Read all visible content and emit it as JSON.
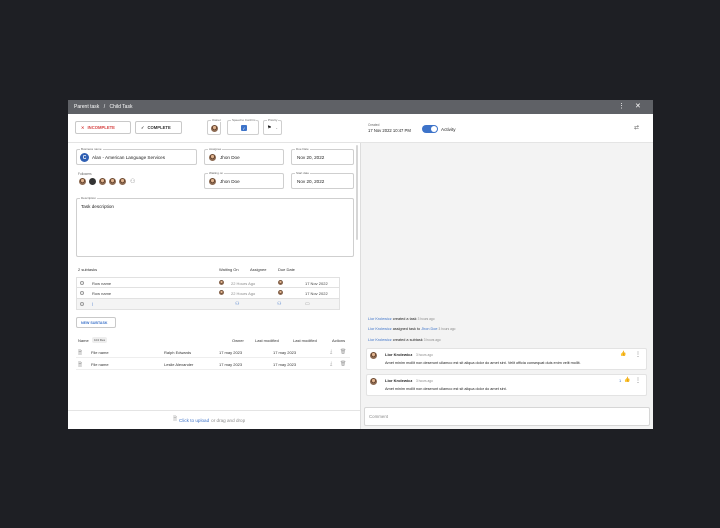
{
  "titlebar": {
    "parent": "Parent task",
    "separator": "/",
    "child": "Child Task"
  },
  "actions": {
    "incomplete_label": "INCOMPLETE",
    "complete_label": "COMPLETE"
  },
  "meta": {
    "owner_label": "Owner",
    "speed_label": "Speed to Confirm",
    "priority_label": "Priority",
    "priority_value": "-"
  },
  "created": {
    "label": "Created",
    "value": "17 Nov 2022 10:47 PM"
  },
  "activity_label": "Activity",
  "fields": {
    "business_name_label": "Business name",
    "business_name_value": "Alan - American Language Services",
    "assignee_label": "Assignee",
    "assignee_value": "Jhon Doe",
    "due_date_label": "Due Date",
    "due_date_value": "Nov 20, 2022",
    "followers_label": "Followers",
    "waiting_label": "Waiting on",
    "waiting_value": "Jhon Doe",
    "start_date_label": "Start date",
    "start_date_value": "Nov 20, 2022",
    "description_label": "Description",
    "description_value": "Task description"
  },
  "subtasks": {
    "header": "2 subtasks",
    "col_waiting": "Waiting On",
    "col_assignee": "Assignee",
    "col_due": "Due Date",
    "rows": [
      {
        "name": "Row name",
        "waiting": "22 Hours Ago",
        "due": "17 Nov 2022"
      },
      {
        "name": "Row name",
        "waiting": "22 Hours Ago",
        "due": "17 Nov 2022"
      }
    ],
    "new_row_placeholder": "|",
    "new_button": "NEW SUBTASK"
  },
  "files": {
    "col_name": "Name",
    "size_badge": "104 files",
    "col_owner": "Owner",
    "col_lastmod1": "Last modified",
    "col_lastmod2": "Last modified",
    "col_actions": "Actions",
    "rows": [
      {
        "name": "File name",
        "owner": "Ralph Edwards",
        "mod1": "17 may 2023",
        "mod2": "17 may 2023"
      },
      {
        "name": "File name",
        "owner": "Leslie Alexander",
        "mod1": "17 may 2023",
        "mod2": "17 may 2023"
      }
    ],
    "upload_link": "Click to upload",
    "upload_rest": "or drag and drop"
  },
  "activity_log": [
    {
      "user": "Lior Krolewicz",
      "action": "created a task",
      "time": "3 hours ago"
    },
    {
      "user": "Lior Krolewicz",
      "action": "assigned task to",
      "target": "Jhon Doe",
      "time": "3 hours ago"
    },
    {
      "user": "Lior Krolewicz",
      "action": "created a subtask",
      "time": "3 hours ago"
    }
  ],
  "comments": [
    {
      "author": "Lior Krolewicz",
      "time": "3 hours ago",
      "text": "Amet minim mollit non deserunt ullamco est sit aliqua dolor do amet sint. Velit officia consequat duis enim velit mollit.",
      "likes": ""
    },
    {
      "author": "Lior Krolewicz",
      "time": "3 hours ago",
      "text": "Amet minim mollit non deserunt ullamco est sit aliqua dolor do amet sint.",
      "likes": "1"
    }
  ],
  "comment_placeholder": "Comment",
  "colors": {
    "accent": "#3d73c9",
    "titlebar": "#5f6166",
    "incomplete": "#d64545"
  }
}
